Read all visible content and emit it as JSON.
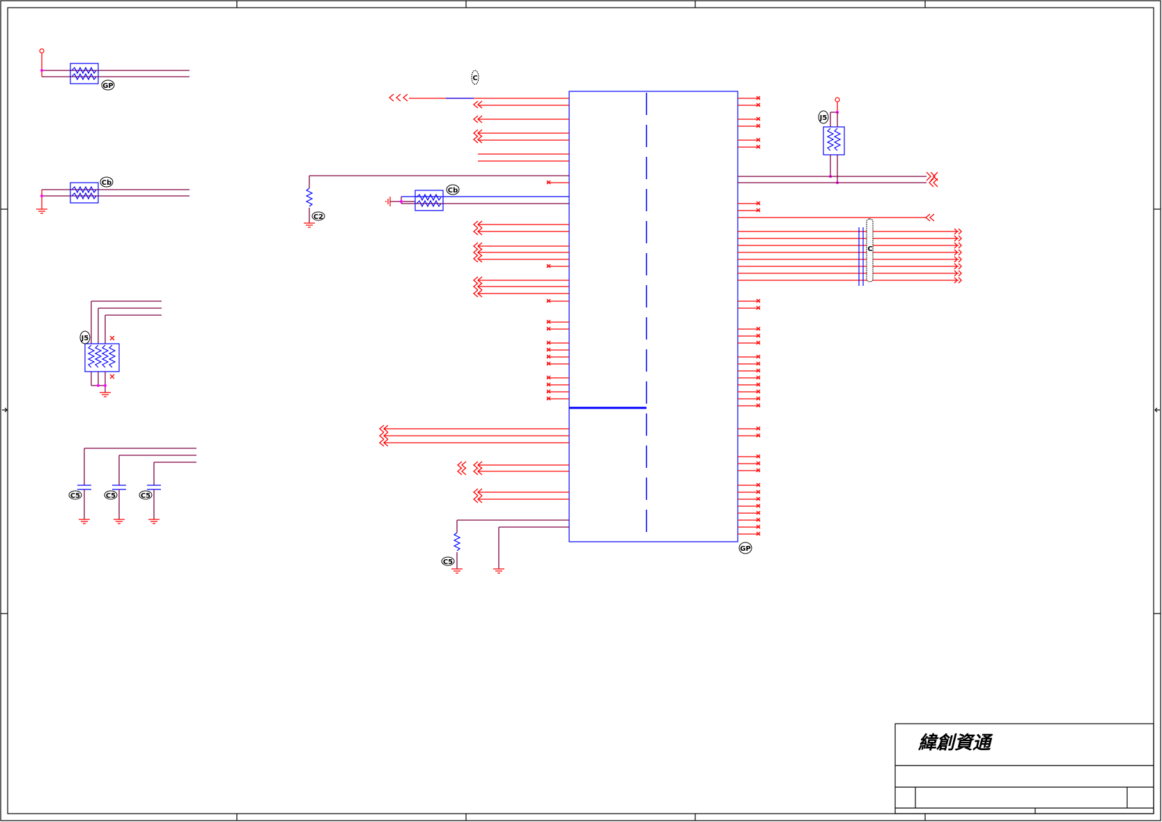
{
  "title_block": {
    "company_name": "緯創資通"
  },
  "reference_labels": {
    "tl_resistor_pack": "GP",
    "l_resistor_pack": "Cb",
    "center_resistor_pack": "Cb",
    "ic_marker": "GP",
    "left_array": "J5",
    "right_array": "J5",
    "center_pulldown": "C2",
    "bottom_pulldown": "C5",
    "cap_1": "C5",
    "cap_2": "C5",
    "cap_3": "C5",
    "top_connector": "C",
    "bus_capacitors": "C"
  },
  "colors": {
    "net_wire": "#ff0000",
    "power_wire": "#800040",
    "component_body": "#0000ff",
    "junction": "#ff00ff",
    "frame": "#000000"
  }
}
